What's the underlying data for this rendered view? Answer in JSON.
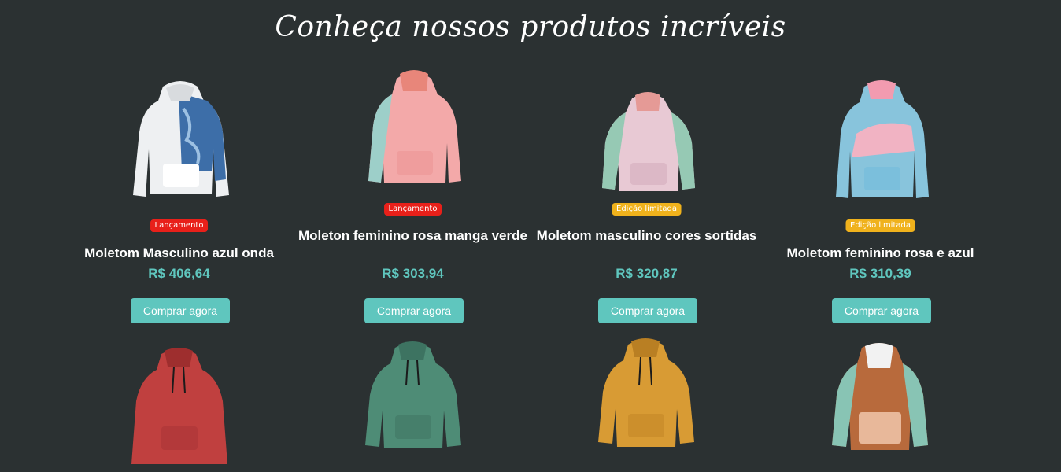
{
  "heading": "Conheça nossos produtos incríveis",
  "buy_label": "Comprar agora",
  "colors": {
    "accent": "#5fc6be",
    "badge_red": "#e8201a",
    "badge_yellow": "#f0b21c",
    "background": "#2b3132"
  },
  "products": [
    {
      "name": "Moletom Masculino azul onda",
      "price": "R$ 406,64",
      "badge": "Lançamento",
      "icon": "blue-wave-hoodie-icon"
    },
    {
      "name": "Moleton feminino rosa manga verde",
      "price": "R$ 303,94",
      "badge": "Lançamento",
      "icon": "pink-green-hoodie-icon"
    },
    {
      "name": "Moletom masculino cores sortidas",
      "price": "R$ 320,87",
      "badge": "Edição limitada",
      "icon": "pastel-hoodie-icon"
    },
    {
      "name": "Moletom feminino rosa e azul",
      "price": "R$ 310,39",
      "badge": "Edição limitada",
      "icon": "pink-blue-hoodie-icon"
    }
  ],
  "more_products": [
    {
      "icon": "red-hoodie-icon"
    },
    {
      "icon": "green-hoodie-icon"
    },
    {
      "icon": "mustard-hoodie-icon"
    },
    {
      "icon": "brown-hoodie-icon"
    }
  ]
}
